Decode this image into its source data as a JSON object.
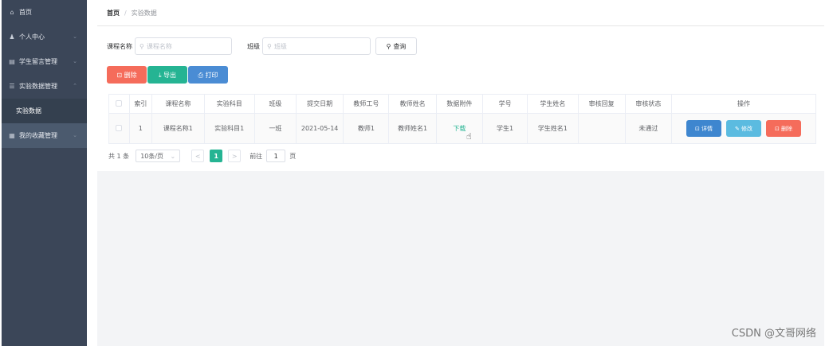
{
  "sidebar": {
    "items": [
      {
        "icon": "⌂",
        "label": "首页",
        "chevron": ""
      },
      {
        "icon": "♟",
        "label": "个人中心",
        "chevron": "⌄"
      },
      {
        "icon": "▤",
        "label": "学生留言管理",
        "chevron": "⌄"
      },
      {
        "icon": "☰",
        "label": "实验数据管理",
        "chevron": "⌃"
      },
      {
        "icon": "",
        "label": "实验数据",
        "chevron": ""
      },
      {
        "icon": "▦",
        "label": "我的收藏管理",
        "chevron": "⌄"
      }
    ]
  },
  "breadcrumb": {
    "home": "首页",
    "separator": "/",
    "current": "实验数据"
  },
  "search": {
    "course_label": "课程名称",
    "course_placeholder": "课程名称",
    "class_label": "班级",
    "class_placeholder": "班级",
    "query_label": "查询",
    "search_icon": "⚲"
  },
  "actions": {
    "delete": "⊡ 删除",
    "export": "⤓ 导出",
    "print": "⎙ 打印"
  },
  "table": {
    "headers": [
      "",
      "索引",
      "课程名称",
      "实验科目",
      "班级",
      "提交日期",
      "教师工号",
      "教师姓名",
      "数据附件",
      "学号",
      "学生姓名",
      "审核回复",
      "审核状态",
      "操作"
    ],
    "row": {
      "index": "1",
      "course": "课程名称1",
      "subject": "实验科目1",
      "class": "一班",
      "date": "2021-05-14",
      "teacher_id": "教师1",
      "teacher_name": "教师姓名1",
      "attachment": "下载",
      "student_id": "学生1",
      "student_name": "学生姓名1",
      "reply": "",
      "status": "未通过",
      "ops": {
        "detail": "⊡ 详情",
        "edit": "✎ 修改",
        "delete": "⊡ 删除"
      }
    }
  },
  "pager": {
    "total": "共 1 条",
    "page_size": "10条/页",
    "prev": "<",
    "current": "1",
    "next": ">",
    "goto": "前往",
    "goto_value": "1",
    "page_unit": "页"
  },
  "watermark": "CSDN @文哥网络",
  "colors": {
    "sidebar": "#3b4658",
    "primary_green": "#25b493",
    "danger": "#f56c5b",
    "info": "#4a8cd4"
  }
}
